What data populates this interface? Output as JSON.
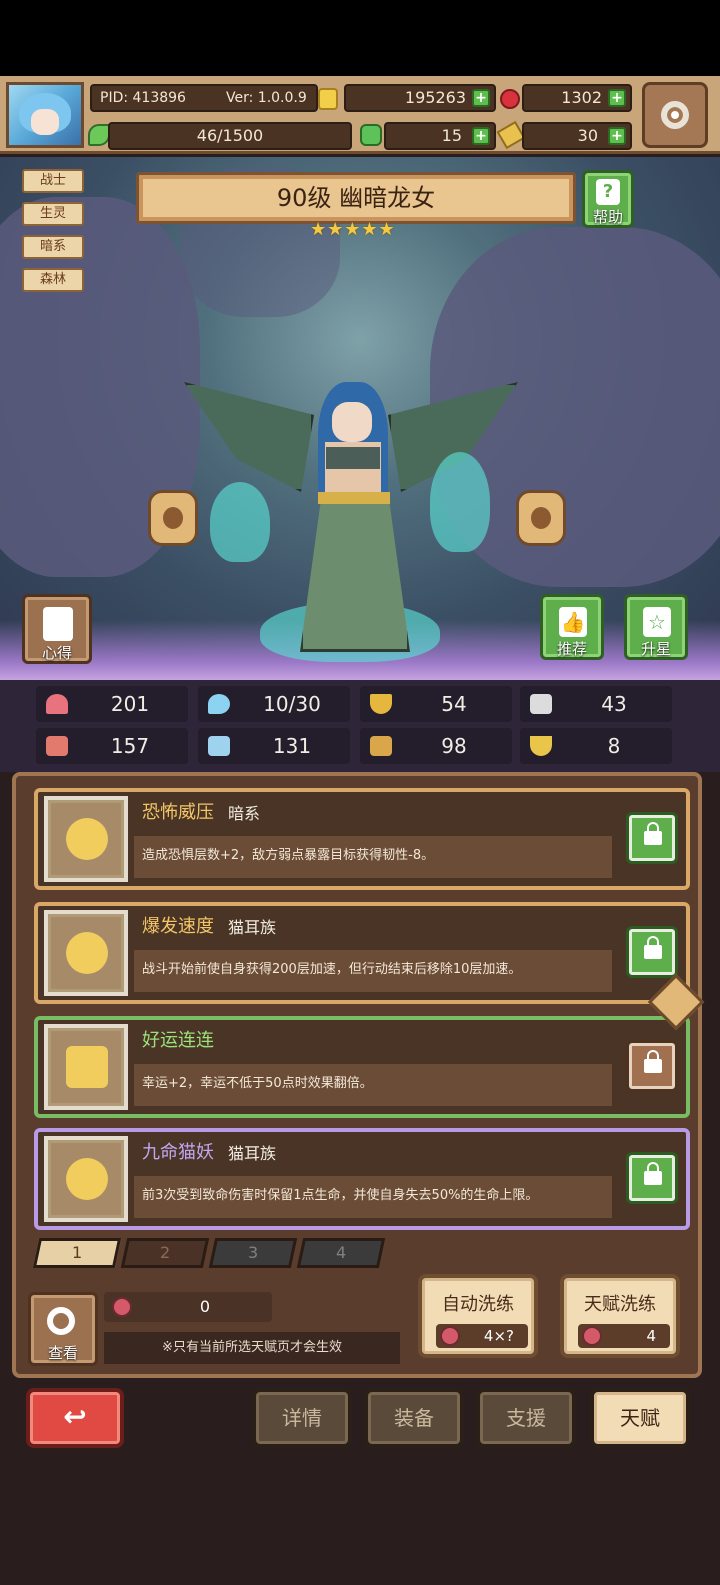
{
  "header": {
    "pid": "PID: 413896",
    "version": "Ver: 1.0.0.9",
    "gold": "195263",
    "gems": "1302",
    "stamina": "46/1500",
    "clover": "15",
    "tool": "30",
    "plus": "+"
  },
  "hero": {
    "tags": [
      "战士",
      "生灵",
      "暗系",
      "森林"
    ],
    "title": "90级 幽暗龙女",
    "stars": "★★★★★",
    "help_label": "帮助",
    "insight_label": "心得",
    "recommend_label": "推荐",
    "star_up_label": "升星"
  },
  "stats": {
    "hp": "201",
    "mana": "10/30",
    "defense": "54",
    "speed": "43",
    "attack": "157",
    "magic": "131",
    "armor": "98",
    "luck": "8"
  },
  "talents": [
    {
      "name": "恐怖威压",
      "tag": "暗系",
      "desc": "造成恐惧层数+2，敌方弱点暴露目标获得韧性-8。",
      "locked": true
    },
    {
      "name": "爆发速度",
      "tag": "猫耳族",
      "desc": "战斗开始前使自身获得200层加速，但行动结束后移除10层加速。",
      "locked": true
    },
    {
      "name": "好运连连",
      "tag": "",
      "desc": "幸运+2，幸运不低于50点时效果翻倍。",
      "locked": false
    },
    {
      "name": "九命猫妖",
      "tag": "猫耳族",
      "desc": "前3次受到致命伤害时保留1点生命，并使自身失去50%的生命上限。",
      "locked": true
    }
  ],
  "pages": [
    "1",
    "2",
    "3",
    "4"
  ],
  "seed_count": "0",
  "notice": "※只有当前所选天赋页才会生效",
  "view_label": "查看",
  "auto_refine": {
    "label": "自动洗练",
    "cost": "4×?"
  },
  "talent_refine": {
    "label": "天赋洗练",
    "cost": "4"
  },
  "nav": {
    "back": "↩",
    "details": "详情",
    "equipment": "装备",
    "support": "支援",
    "talent": "天赋"
  }
}
